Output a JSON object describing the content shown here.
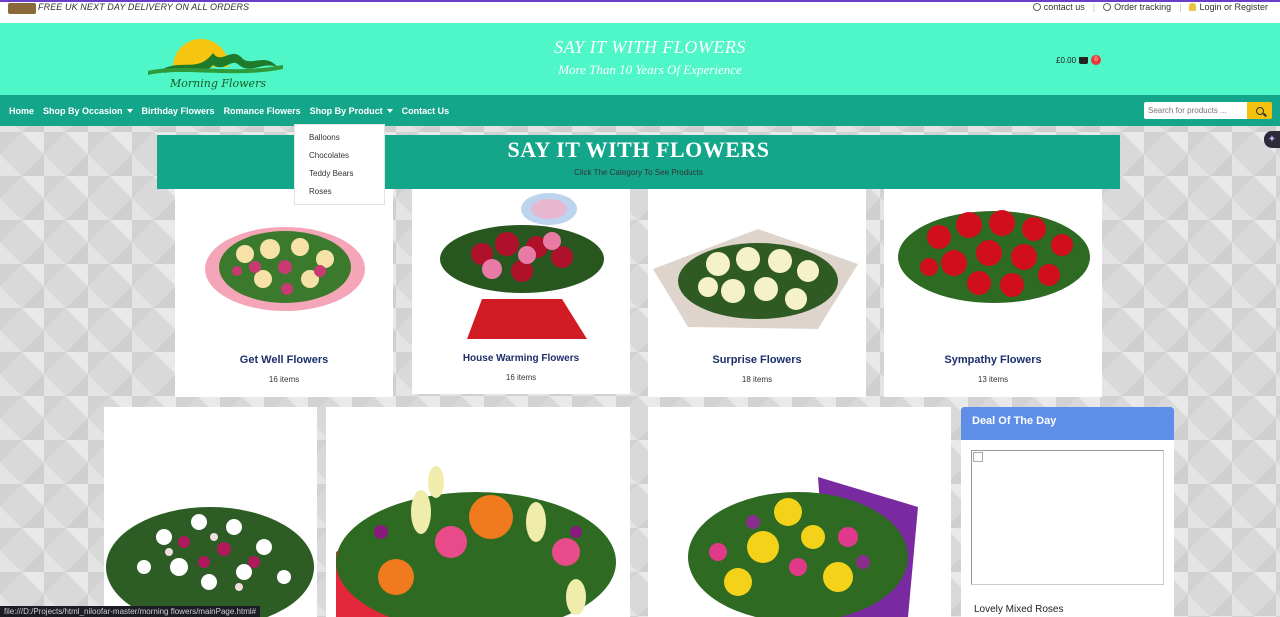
{
  "topbar": {
    "promo": "FREE UK NEXT DAY DELIVERY ON ALL ORDERS",
    "contact": "contact us",
    "tracking": "Order tracking",
    "login": "Login or Register"
  },
  "header": {
    "logo_text": "Morning Flowers",
    "slogan_title": "SAY IT WITH FLOWERS",
    "slogan_sub": "More Than 10 Years Of Experience",
    "cart_total": "£0.00",
    "cart_count": "0"
  },
  "nav": {
    "home": "Home",
    "occasion": "Shop By Occasion",
    "birthday": "Birthday Flowers",
    "romance": "Romance Flowers",
    "product": "Shop By Product",
    "contact": "Contact Us",
    "search_placeholder": "Search for products ..."
  },
  "dropdown": [
    "Balloons",
    "Chocolates",
    "Teddy Bears",
    "Roses"
  ],
  "banner": {
    "title": "SAY IT WITH FLOWERS",
    "subtitle": "Click The Category To See Products"
  },
  "categories": [
    {
      "name": "Get Well Flowers",
      "count": "16 items"
    },
    {
      "name": "House Warming Flowers",
      "count": "16 items"
    },
    {
      "name": "Surprise Flowers",
      "count": "18 items"
    },
    {
      "name": "Sympathy Flowers",
      "count": "13 items"
    }
  ],
  "deal": {
    "title": "Deal Of The Day",
    "product": "Lovely Mixed Roses"
  },
  "statusbar": "file:///D:/Projects/html_niloofar-master/morning flowers/mainPage.html#"
}
